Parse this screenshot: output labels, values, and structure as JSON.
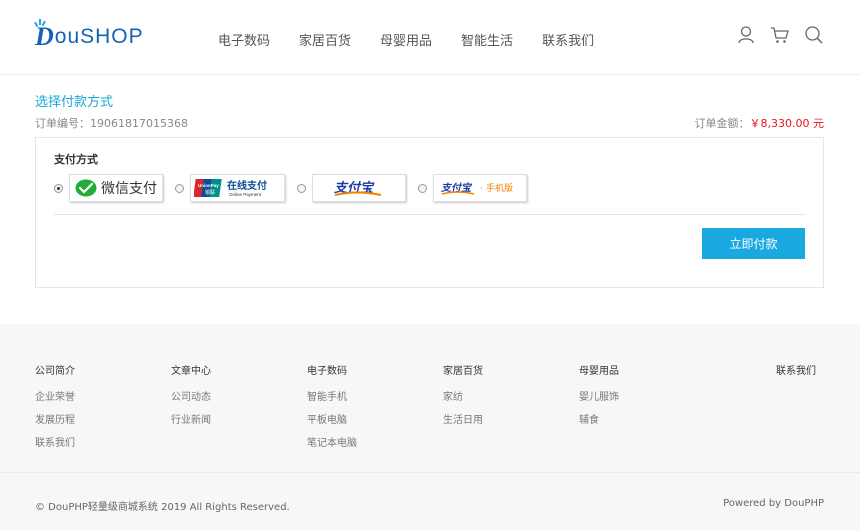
{
  "header": {
    "logo_d": "D",
    "logo_rest": "ouSHOP",
    "nav": [
      "电子数码",
      "家居百货",
      "母婴用品",
      "智能生活",
      "联系我们"
    ],
    "icons": [
      "user-icon",
      "cart-icon",
      "search-icon"
    ]
  },
  "order": {
    "title": "选择付款方式",
    "order_no": "订单编号：19061817015368",
    "total_label": "订单金额：",
    "total_amount": "￥8,330.00 元"
  },
  "payment": {
    "label": "支付方式",
    "wechat": "微信支付",
    "unionpay_cn": "在线支付",
    "unionpay_en": "Online Payment",
    "unionpay_brand": "UnionPay",
    "unionpay_sub": "银联",
    "alipay": "支付宝",
    "alipay_mobile_sep": "·",
    "alipay_mobile": "手机版",
    "submit": "立即付款",
    "colors": {
      "accent": "#1aa8e0",
      "price": "#e4161e",
      "title": "#19a7d8"
    }
  },
  "footer": {
    "columns": [
      {
        "title": "公司简介",
        "links": [
          "企业荣誉",
          "发展历程",
          "联系我们"
        ]
      },
      {
        "title": "文章中心",
        "links": [
          "公司动态",
          "行业新闻"
        ]
      },
      {
        "title": "电子数码",
        "links": [
          "智能手机",
          "平板电脑",
          "笔记本电脑"
        ]
      },
      {
        "title": "家居百货",
        "links": [
          "家纺",
          "生活日用"
        ]
      },
      {
        "title": "母婴用品",
        "links": [
          "婴儿服饰",
          "辅食"
        ]
      }
    ],
    "contact": "联系我们",
    "copyright": "© DouPHP轻量级商城系统 2019 All Rights Reserved.",
    "powered": "Powered by DouPHP"
  }
}
